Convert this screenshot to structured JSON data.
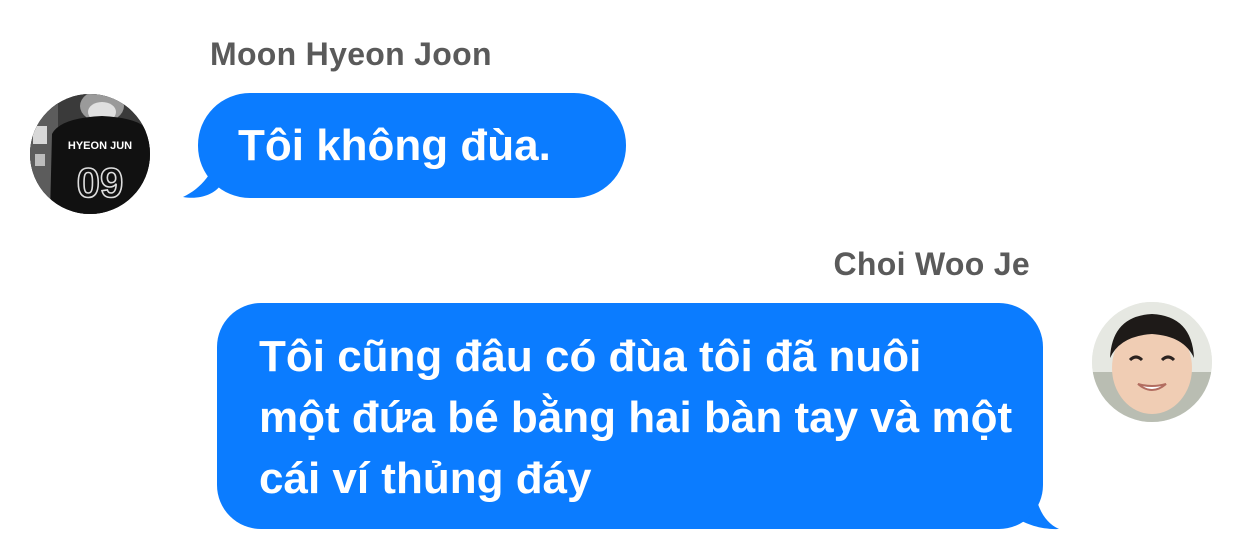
{
  "conversation": {
    "messages": [
      {
        "sender": "Moon Hyeon Joon",
        "avatar_jersey_name": "HYEON JUN",
        "avatar_jersey_number": "09",
        "text": "Tôi không đùa.",
        "side": "left"
      },
      {
        "sender": "Choi Woo Je",
        "text": "Tôi cũng đâu có đùa tôi đã nuôi một đứa bé bằng hai bàn tay và một cái ví thủng đáy",
        "side": "right"
      }
    ],
    "colors": {
      "bubble": "#0b7cff",
      "bubble_text": "#ffffff",
      "sender_name": "#5a5a5a",
      "background": "#ffffff"
    }
  }
}
